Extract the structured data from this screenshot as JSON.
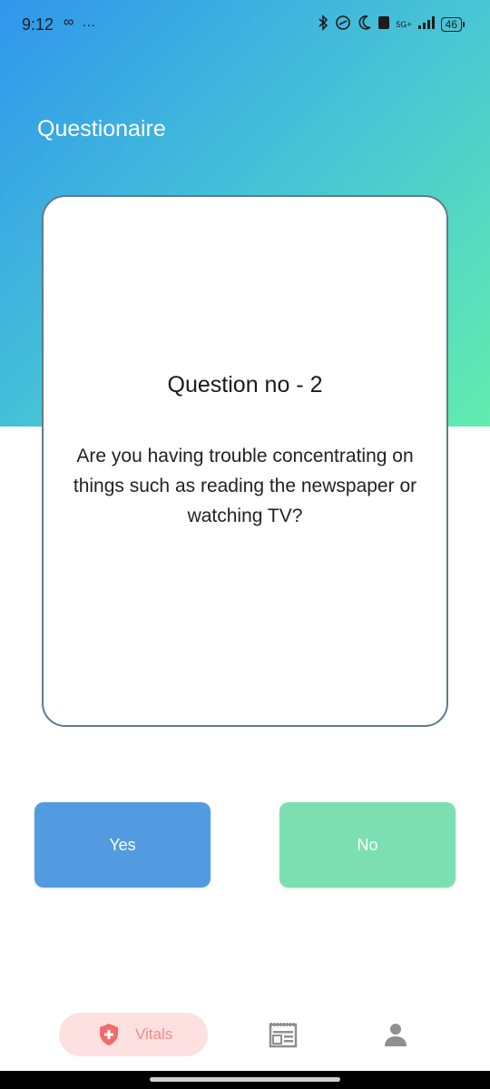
{
  "status_bar": {
    "time": "9:12",
    "left_icons": "∞ …",
    "network_top": "5G+",
    "battery": "46"
  },
  "header": {
    "title": "Questionaire"
  },
  "question": {
    "number_label": "Question no - 2",
    "text": "Are you having trouble concentrating on things such as reading the newspaper or watching TV?"
  },
  "answers": {
    "yes_label": "Yes",
    "no_label": "No"
  },
  "bottom_nav": {
    "vitals_label": "Vitals"
  },
  "colors": {
    "gradient_start": "#2f96ec",
    "gradient_end": "#62edae",
    "yes_button": "#529be0",
    "no_button": "#7bdfb2",
    "vitals_active_bg": "#fde0e0",
    "vitals_active_fg": "#f07a7a",
    "card_border": "#5f7b8b"
  },
  "icons": {
    "status": [
      "bluetooth-icon",
      "link-icon",
      "moon-icon",
      "volte-icon",
      "signal-icon",
      "battery-icon"
    ],
    "nav": [
      "shield-plus-icon",
      "newspaper-icon",
      "person-icon"
    ]
  }
}
